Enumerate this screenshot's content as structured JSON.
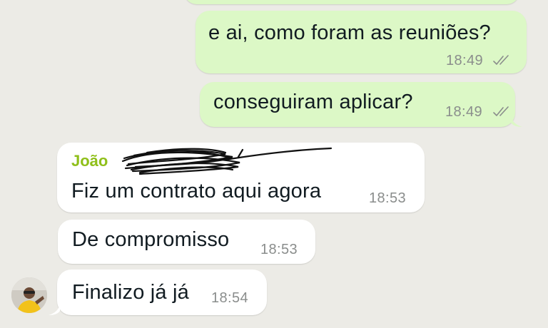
{
  "messages": [
    {
      "text": "e ai, como foram as reuniões?",
      "time": "18:49",
      "direction": "outgoing",
      "status": "read"
    },
    {
      "text": "conseguiram aplicar?",
      "time": "18:49",
      "direction": "outgoing",
      "status": "read"
    },
    {
      "sender": "João",
      "text": "Fiz um contrato aqui agora",
      "time": "18:53",
      "direction": "incoming"
    },
    {
      "text": "De compromisso",
      "time": "18:53",
      "direction": "incoming"
    },
    {
      "text": "Finalizo já já",
      "time": "18:54",
      "direction": "incoming"
    }
  ],
  "colors": {
    "background": "#ecebe6",
    "outgoing_bubble": "#dcf8c6",
    "incoming_bubble": "#ffffff",
    "sender_name": "#8fbf1a",
    "timestamp": "#8a8d8c",
    "read_ticks": "#8a8d8c"
  },
  "icons": {
    "read_status": "double-check-icon",
    "avatar": "contact-avatar"
  }
}
